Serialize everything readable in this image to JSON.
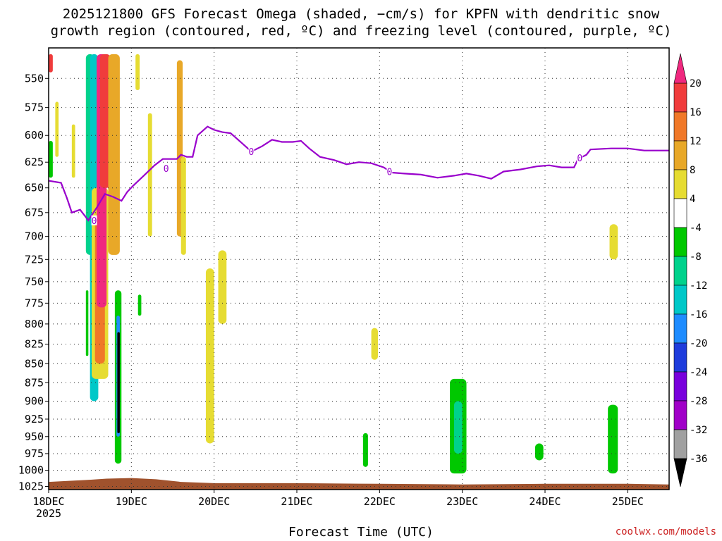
{
  "title": {
    "line1": "2025121800 GFS Forecast Omega (shaded, −cm/s) for KPFN with dendritic snow",
    "line2": "growth region (contoured, red, ºC) and freezing level (contoured, purple, ºC)"
  },
  "credit": "coolwx.com/models",
  "chart_data": {
    "type": "heatmap",
    "title": "2025121800 GFS Forecast Omega (shaded, −cm/s) for KPFN with dendritic snow growth region (contoured, red, ºC) and freezing level (contoured, purple, ºC)",
    "xlabel": "Forecast Time (UTC)",
    "ylabel": "",
    "x_ticks": [
      "18DEC\n2025",
      "19DEC",
      "20DEC",
      "21DEC",
      "22DEC",
      "23DEC",
      "24DEC",
      "25DEC"
    ],
    "x_tick_days": [
      0,
      1,
      2,
      3,
      4,
      5,
      6,
      7
    ],
    "x_range_days": [
      0,
      7.5
    ],
    "y_ticks": [
      550,
      575,
      600,
      625,
      650,
      675,
      700,
      725,
      750,
      775,
      800,
      825,
      850,
      875,
      900,
      925,
      950,
      975,
      1000,
      1025
    ],
    "y_range_hpa": [
      525,
      1030
    ],
    "y_scale": "log-pressure",
    "grid": true,
    "colorbar": {
      "labels": [
        "20",
        "16",
        "12",
        "8",
        "4",
        "-4",
        "-8",
        "-12",
        "-16",
        "-20",
        "-24",
        "-28",
        "-32",
        "-36"
      ],
      "colors": [
        "#f03c3c",
        "#f07828",
        "#e8a828",
        "#e6dc32",
        "#ffffff",
        "#00c800",
        "#00d28c",
        "#00c8c8",
        "#1e8cff",
        "#1e3cdc",
        "#7800dc",
        "#a000c8",
        "#a0a0a0"
      ],
      "top_color": "#f0287f",
      "bottom_color": "#000000"
    },
    "freezing_level": {
      "label": "0",
      "color": "#9900cc",
      "points": [
        [
          0.0,
          643
        ],
        [
          0.15,
          645
        ],
        [
          0.22,
          660
        ],
        [
          0.28,
          675
        ],
        [
          0.38,
          672
        ],
        [
          0.48,
          683
        ],
        [
          0.58,
          670
        ],
        [
          0.68,
          656
        ],
        [
          0.78,
          659
        ],
        [
          0.88,
          663
        ],
        [
          0.95,
          654
        ],
        [
          1.02,
          648
        ],
        [
          1.15,
          638
        ],
        [
          1.28,
          628
        ],
        [
          1.38,
          622
        ],
        [
          1.48,
          622
        ],
        [
          1.55,
          622
        ],
        [
          1.6,
          618
        ],
        [
          1.67,
          620
        ],
        [
          1.74,
          620
        ],
        [
          1.8,
          600
        ],
        [
          1.92,
          592
        ],
        [
          2.0,
          595
        ],
        [
          2.1,
          597
        ],
        [
          2.2,
          598
        ],
        [
          2.35,
          608
        ],
        [
          2.45,
          615
        ],
        [
          2.58,
          610
        ],
        [
          2.7,
          604
        ],
        [
          2.82,
          606
        ],
        [
          2.95,
          606
        ],
        [
          3.05,
          605
        ],
        [
          3.15,
          612
        ],
        [
          3.28,
          620
        ],
        [
          3.45,
          623
        ],
        [
          3.6,
          627
        ],
        [
          3.75,
          625
        ],
        [
          3.9,
          626
        ],
        [
          4.05,
          630
        ],
        [
          4.15,
          635
        ],
        [
          4.3,
          636
        ],
        [
          4.5,
          637
        ],
        [
          4.7,
          640
        ],
        [
          4.9,
          638
        ],
        [
          5.05,
          636
        ],
        [
          5.2,
          638
        ],
        [
          5.35,
          641
        ],
        [
          5.5,
          634
        ],
        [
          5.7,
          632
        ],
        [
          5.9,
          629
        ],
        [
          6.05,
          628
        ],
        [
          6.2,
          630
        ],
        [
          6.35,
          630
        ],
        [
          6.4,
          622
        ],
        [
          6.5,
          618
        ],
        [
          6.55,
          613
        ],
        [
          6.8,
          612
        ],
        [
          7.0,
          612
        ],
        [
          7.2,
          614
        ],
        [
          7.5,
          614
        ]
      ]
    },
    "omega_regions": [
      {
        "t0": 0.0,
        "t1": 0.05,
        "p0": 530,
        "p1": 545,
        "color": "#f03c3c"
      },
      {
        "t0": 0.08,
        "t1": 0.12,
        "p0": 570,
        "p1": 620,
        "color": "#e6dc32"
      },
      {
        "t0": 0.0,
        "t1": 0.05,
        "p0": 605,
        "p1": 640,
        "color": "#00c800"
      },
      {
        "t0": 0.28,
        "t1": 0.32,
        "p0": 590,
        "p1": 640,
        "color": "#e6dc32"
      },
      {
        "t0": 0.45,
        "t1": 0.55,
        "p0": 530,
        "p1": 720,
        "color": "#00d28c"
      },
      {
        "t0": 0.5,
        "t1": 0.6,
        "p0": 530,
        "p1": 900,
        "color": "#00c8c8"
      },
      {
        "t0": 0.52,
        "t1": 0.72,
        "p0": 650,
        "p1": 870,
        "color": "#e6dc32"
      },
      {
        "t0": 0.56,
        "t1": 0.68,
        "p0": 680,
        "p1": 850,
        "color": "#f07828"
      },
      {
        "t0": 0.58,
        "t1": 0.7,
        "p0": 530,
        "p1": 780,
        "color": "#f0287f"
      },
      {
        "t0": 0.62,
        "t1": 0.75,
        "p0": 530,
        "p1": 650,
        "color": "#f03c3c"
      },
      {
        "t0": 0.72,
        "t1": 0.86,
        "p0": 530,
        "p1": 720,
        "color": "#e8a828"
      },
      {
        "t0": 0.8,
        "t1": 0.88,
        "p0": 760,
        "p1": 990,
        "color": "#00c800"
      },
      {
        "t0": 0.82,
        "t1": 0.86,
        "p0": 790,
        "p1": 950,
        "color": "#1e8cff"
      },
      {
        "t0": 0.83,
        "t1": 0.86,
        "p0": 810,
        "p1": 945,
        "color": "#000000"
      },
      {
        "t0": 0.45,
        "t1": 0.48,
        "p0": 760,
        "p1": 840,
        "color": "#00c800"
      },
      {
        "t0": 1.2,
        "t1": 1.25,
        "p0": 580,
        "p1": 700,
        "color": "#e6dc32"
      },
      {
        "t0": 1.55,
        "t1": 1.62,
        "p0": 535,
        "p1": 700,
        "color": "#e8a828"
      },
      {
        "t0": 1.6,
        "t1": 1.66,
        "p0": 620,
        "p1": 720,
        "color": "#e6dc32"
      },
      {
        "t0": 1.08,
        "t1": 1.12,
        "p0": 765,
        "p1": 790,
        "color": "#00c800"
      },
      {
        "t0": 1.9,
        "t1": 2.0,
        "p0": 735,
        "p1": 960,
        "color": "#e6dc32"
      },
      {
        "t0": 2.05,
        "t1": 2.15,
        "p0": 715,
        "p1": 800,
        "color": "#e6dc32"
      },
      {
        "t0": 1.05,
        "t1": 1.1,
        "p0": 530,
        "p1": 560,
        "color": "#e6dc32"
      },
      {
        "t0": 3.9,
        "t1": 3.98,
        "p0": 805,
        "p1": 845,
        "color": "#e6dc32"
      },
      {
        "t0": 3.8,
        "t1": 3.86,
        "p0": 945,
        "p1": 995,
        "color": "#00c800"
      },
      {
        "t0": 4.85,
        "t1": 5.05,
        "p0": 870,
        "p1": 1005,
        "color": "#00c800"
      },
      {
        "t0": 4.9,
        "t1": 5.0,
        "p0": 900,
        "p1": 975,
        "color": "#00d28c"
      },
      {
        "t0": 5.88,
        "t1": 5.98,
        "p0": 960,
        "p1": 985,
        "color": "#00c800"
      },
      {
        "t0": 6.78,
        "t1": 6.88,
        "p0": 687,
        "p1": 725,
        "color": "#e6dc32"
      },
      {
        "t0": 6.76,
        "t1": 6.88,
        "p0": 905,
        "p1": 1005,
        "color": "#00c800"
      }
    ]
  }
}
